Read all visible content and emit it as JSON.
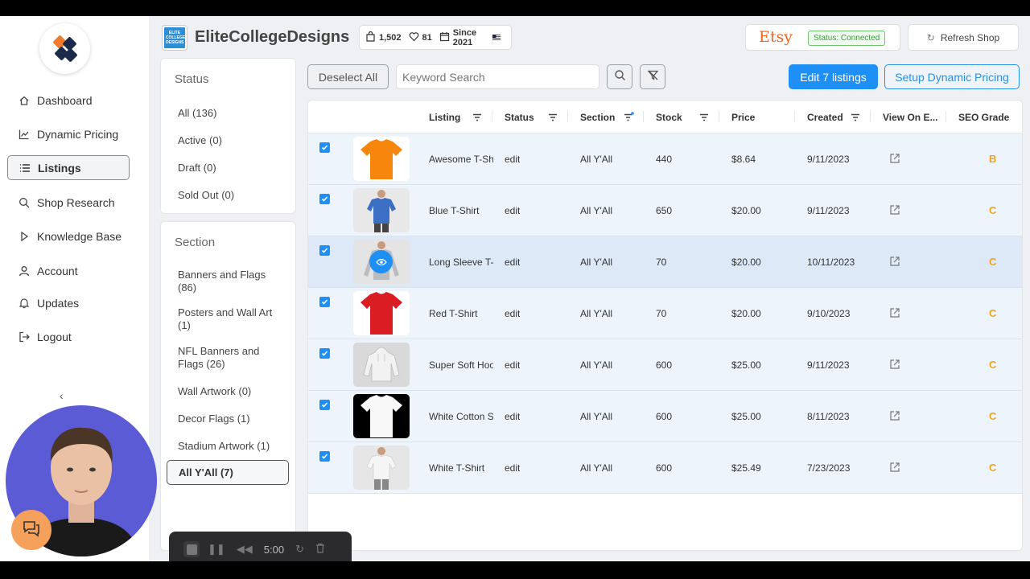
{
  "sidebar": {
    "items": [
      {
        "label": "Dashboard",
        "icon": "home-icon"
      },
      {
        "label": "Dynamic Pricing",
        "icon": "chart-line-icon"
      },
      {
        "label": "Listings",
        "icon": "list-icon",
        "active": true
      },
      {
        "label": "Shop Research",
        "icon": "search-icon"
      },
      {
        "label": "Knowledge Base",
        "icon": "play-triangle-icon"
      },
      {
        "label": "Account",
        "icon": "user-icon"
      },
      {
        "label": "Updates",
        "icon": "bell-icon"
      },
      {
        "label": "Logout",
        "icon": "logout-icon"
      }
    ],
    "collapse_glyph": "‹"
  },
  "header": {
    "shop_logo_text": "ELITE COLLEGE DESIGNS",
    "shop_name": "EliteCollegeDesigns",
    "sales": "1,502",
    "favorites": "81",
    "since": "Since 2021",
    "etsy_logo": "Etsy",
    "status": "Status: Connected",
    "refresh_label": "Refresh Shop"
  },
  "filters": {
    "status_title": "Status",
    "status_items": [
      "All (136)",
      "Active (0)",
      "Draft (0)",
      "Sold Out (0)"
    ],
    "section_title": "Section",
    "section_items": [
      "Banners and Flags (86)",
      "Posters and Wall Art (1)",
      "NFL Banners and Flags (26)",
      "Wall Artwork (0)",
      "Decor Flags (1)",
      "Stadium Artwork (1)",
      "All Y'All (7)"
    ],
    "section_active": "All Y'All (7)"
  },
  "toolbar": {
    "deselect_label": "Deselect All",
    "search_placeholder": "Keyword Search",
    "edit_label": "Edit 7 listings",
    "dynamic_label": "Setup Dynamic Pricing"
  },
  "table": {
    "columns": [
      "Listing",
      "Status",
      "Section",
      "Stock",
      "Price",
      "Created",
      "View On E...",
      "SEO Grade"
    ],
    "rows": [
      {
        "listing": "Awesome T-Shirt",
        "status": "edit",
        "section": "All Y'All",
        "stock": "440",
        "price": "$8.64",
        "created": "9/11/2023",
        "grade": "B",
        "color": "#f7860d"
      },
      {
        "listing": "Blue T-Shirt",
        "status": "edit",
        "section": "All Y'All",
        "stock": "650",
        "price": "$20.00",
        "created": "9/11/2023",
        "grade": "C",
        "color": "#3b6fc4"
      },
      {
        "listing": "Long Sleeve T-Shirt",
        "status": "edit",
        "section": "All Y'All",
        "stock": "70",
        "price": "$20.00",
        "created": "10/11/2023",
        "grade": "C",
        "color": "#b9bcc0"
      },
      {
        "listing": "Red T-Shirt",
        "status": "edit",
        "section": "All Y'All",
        "stock": "70",
        "price": "$20.00",
        "created": "9/10/2023",
        "grade": "C",
        "color": "#d91d23"
      },
      {
        "listing": "Super Soft Hoodie",
        "status": "edit",
        "section": "All Y'All",
        "stock": "600",
        "price": "$25.00",
        "created": "9/11/2023",
        "grade": "C",
        "color": "#f2f2f2"
      },
      {
        "listing": "White Cotton Shirt",
        "status": "edit",
        "section": "All Y'All",
        "stock": "600",
        "price": "$25.00",
        "created": "8/11/2023",
        "grade": "C",
        "color": "#f8f8f8"
      },
      {
        "listing": "White T-Shirt",
        "status": "edit",
        "section": "All Y'All",
        "stock": "600",
        "price": "$25.49",
        "created": "7/23/2023",
        "grade": "C",
        "color": "#f5f5f5"
      }
    ]
  },
  "recorder": {
    "time": "5:00"
  },
  "colors": {
    "accent": "#1e90f5",
    "grade": "#f0a41e",
    "etsy": "#f1641e"
  }
}
